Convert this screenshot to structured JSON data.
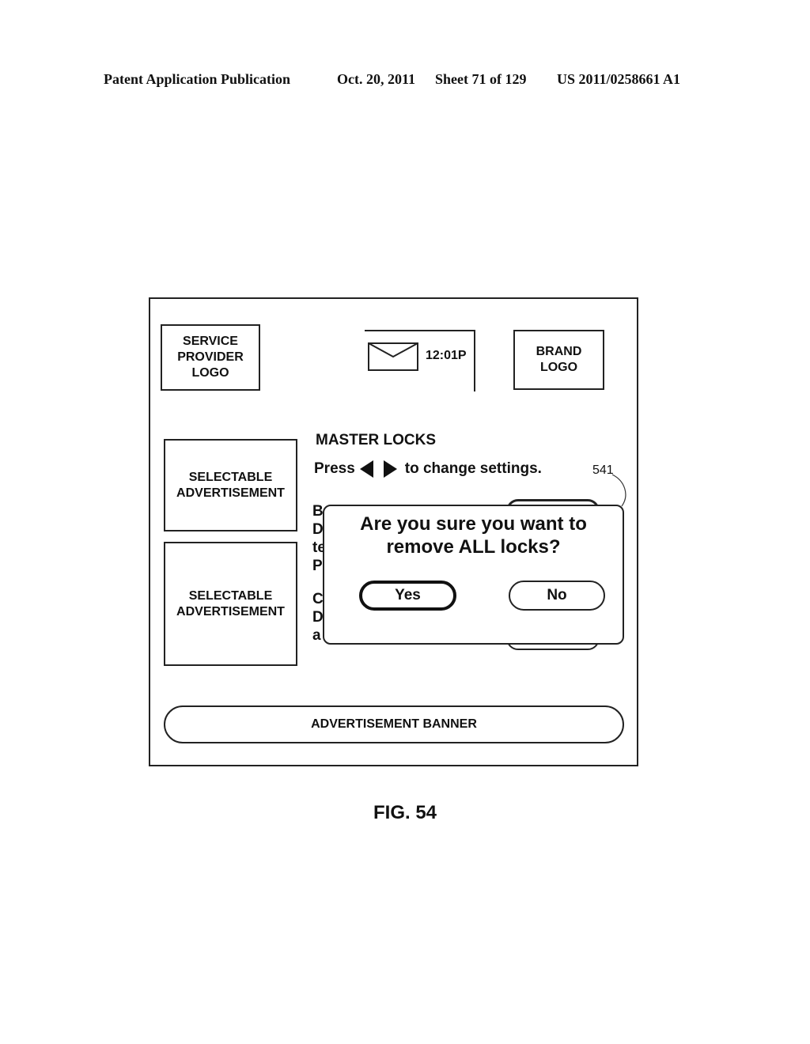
{
  "header": {
    "publication": "Patent Application Publication",
    "date": "Oct. 20, 2011",
    "sheet": "Sheet 71 of 129",
    "number": "US 2011/0258661 A1"
  },
  "screen": {
    "service_provider_logo": "SERVICE\nPROVIDER\nLOGO",
    "brand_logo": "BRAND\nLOGO",
    "status": {
      "icon": "envelope-icon",
      "time": "12:01P"
    },
    "ads": [
      {
        "label": "SELECTABLE\nADVERTISEMENT"
      },
      {
        "label": "SELECTABLE\nADVERTISEMENT"
      }
    ],
    "menu": {
      "title": "MASTER LOCKS",
      "instruction_prefix": "Press",
      "instruction_suffix": "to change settings.",
      "left_arrow_icon": "left-triangle-icon",
      "right_arrow_icon": "right-triangle-icon",
      "obscured_lines": [
        "B",
        "D",
        "te",
        "P",
        "",
        "C",
        "D",
        "a"
      ]
    },
    "dialog": {
      "message_line1": "Are you sure you want to",
      "message_line2": "remove ALL locks?",
      "yes_label": "Yes",
      "no_label": "No"
    },
    "banner": "ADVERTISEMENT BANNER",
    "reference_numeral": "541"
  },
  "figure_label": "FIG. 54"
}
